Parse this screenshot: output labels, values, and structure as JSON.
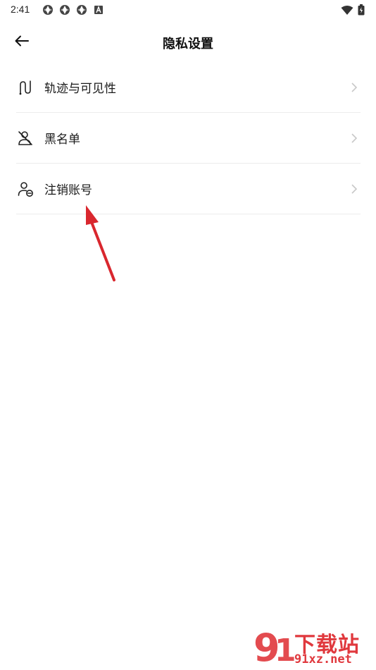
{
  "status_bar": {
    "time": "2:41",
    "icons": [
      "notification-icon",
      "notification-icon",
      "notification-icon",
      "font-a-icon",
      "wifi-icon",
      "battery-icon"
    ]
  },
  "header": {
    "title": "隐私设置",
    "back_icon": "back-arrow-icon"
  },
  "menu": {
    "items": [
      {
        "label": "轨迹与可见性",
        "icon": "route-icon"
      },
      {
        "label": "黑名单",
        "icon": "blocked-user-icon"
      },
      {
        "label": "注销账号",
        "icon": "user-remove-icon"
      }
    ]
  },
  "annotation": {
    "color": "#d9272e",
    "shape": "arrow"
  },
  "watermark": {
    "text": "下载站",
    "logo_text": "91",
    "domain": "91xz.net",
    "color": "#e0383d"
  }
}
